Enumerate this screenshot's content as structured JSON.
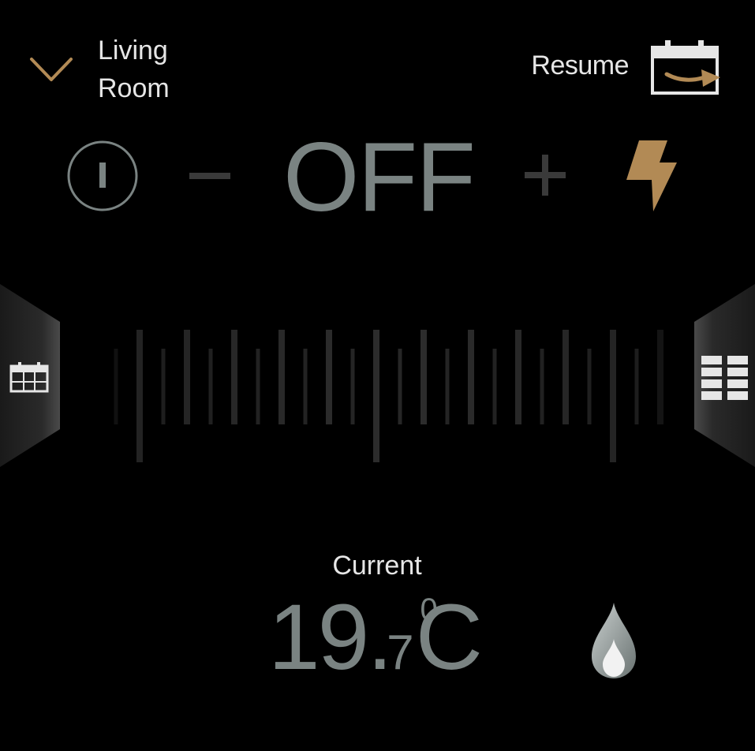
{
  "header": {
    "room_line1": "Living",
    "room_line2": "Room",
    "resume_label": "Resume"
  },
  "controls": {
    "mode_text": "OFF"
  },
  "current": {
    "label": "Current",
    "temp_int": "19",
    "temp_dot": ".",
    "temp_dec": "7",
    "degree": "0",
    "unit": "C"
  },
  "colors": {
    "accent": "#b28a55",
    "text": "#e6e6e6",
    "dim": "#7a8382",
    "background": "#000000"
  },
  "icons": {
    "room_toggle": "chevron-down-icon",
    "resume": "calendar-arrow-icon",
    "power": "power-icon",
    "minus": "minus-icon",
    "plus": "plus-icon",
    "boost": "lightning-icon",
    "schedule": "calendar-icon",
    "grid": "grid-icon",
    "flame": "flame-icon"
  }
}
